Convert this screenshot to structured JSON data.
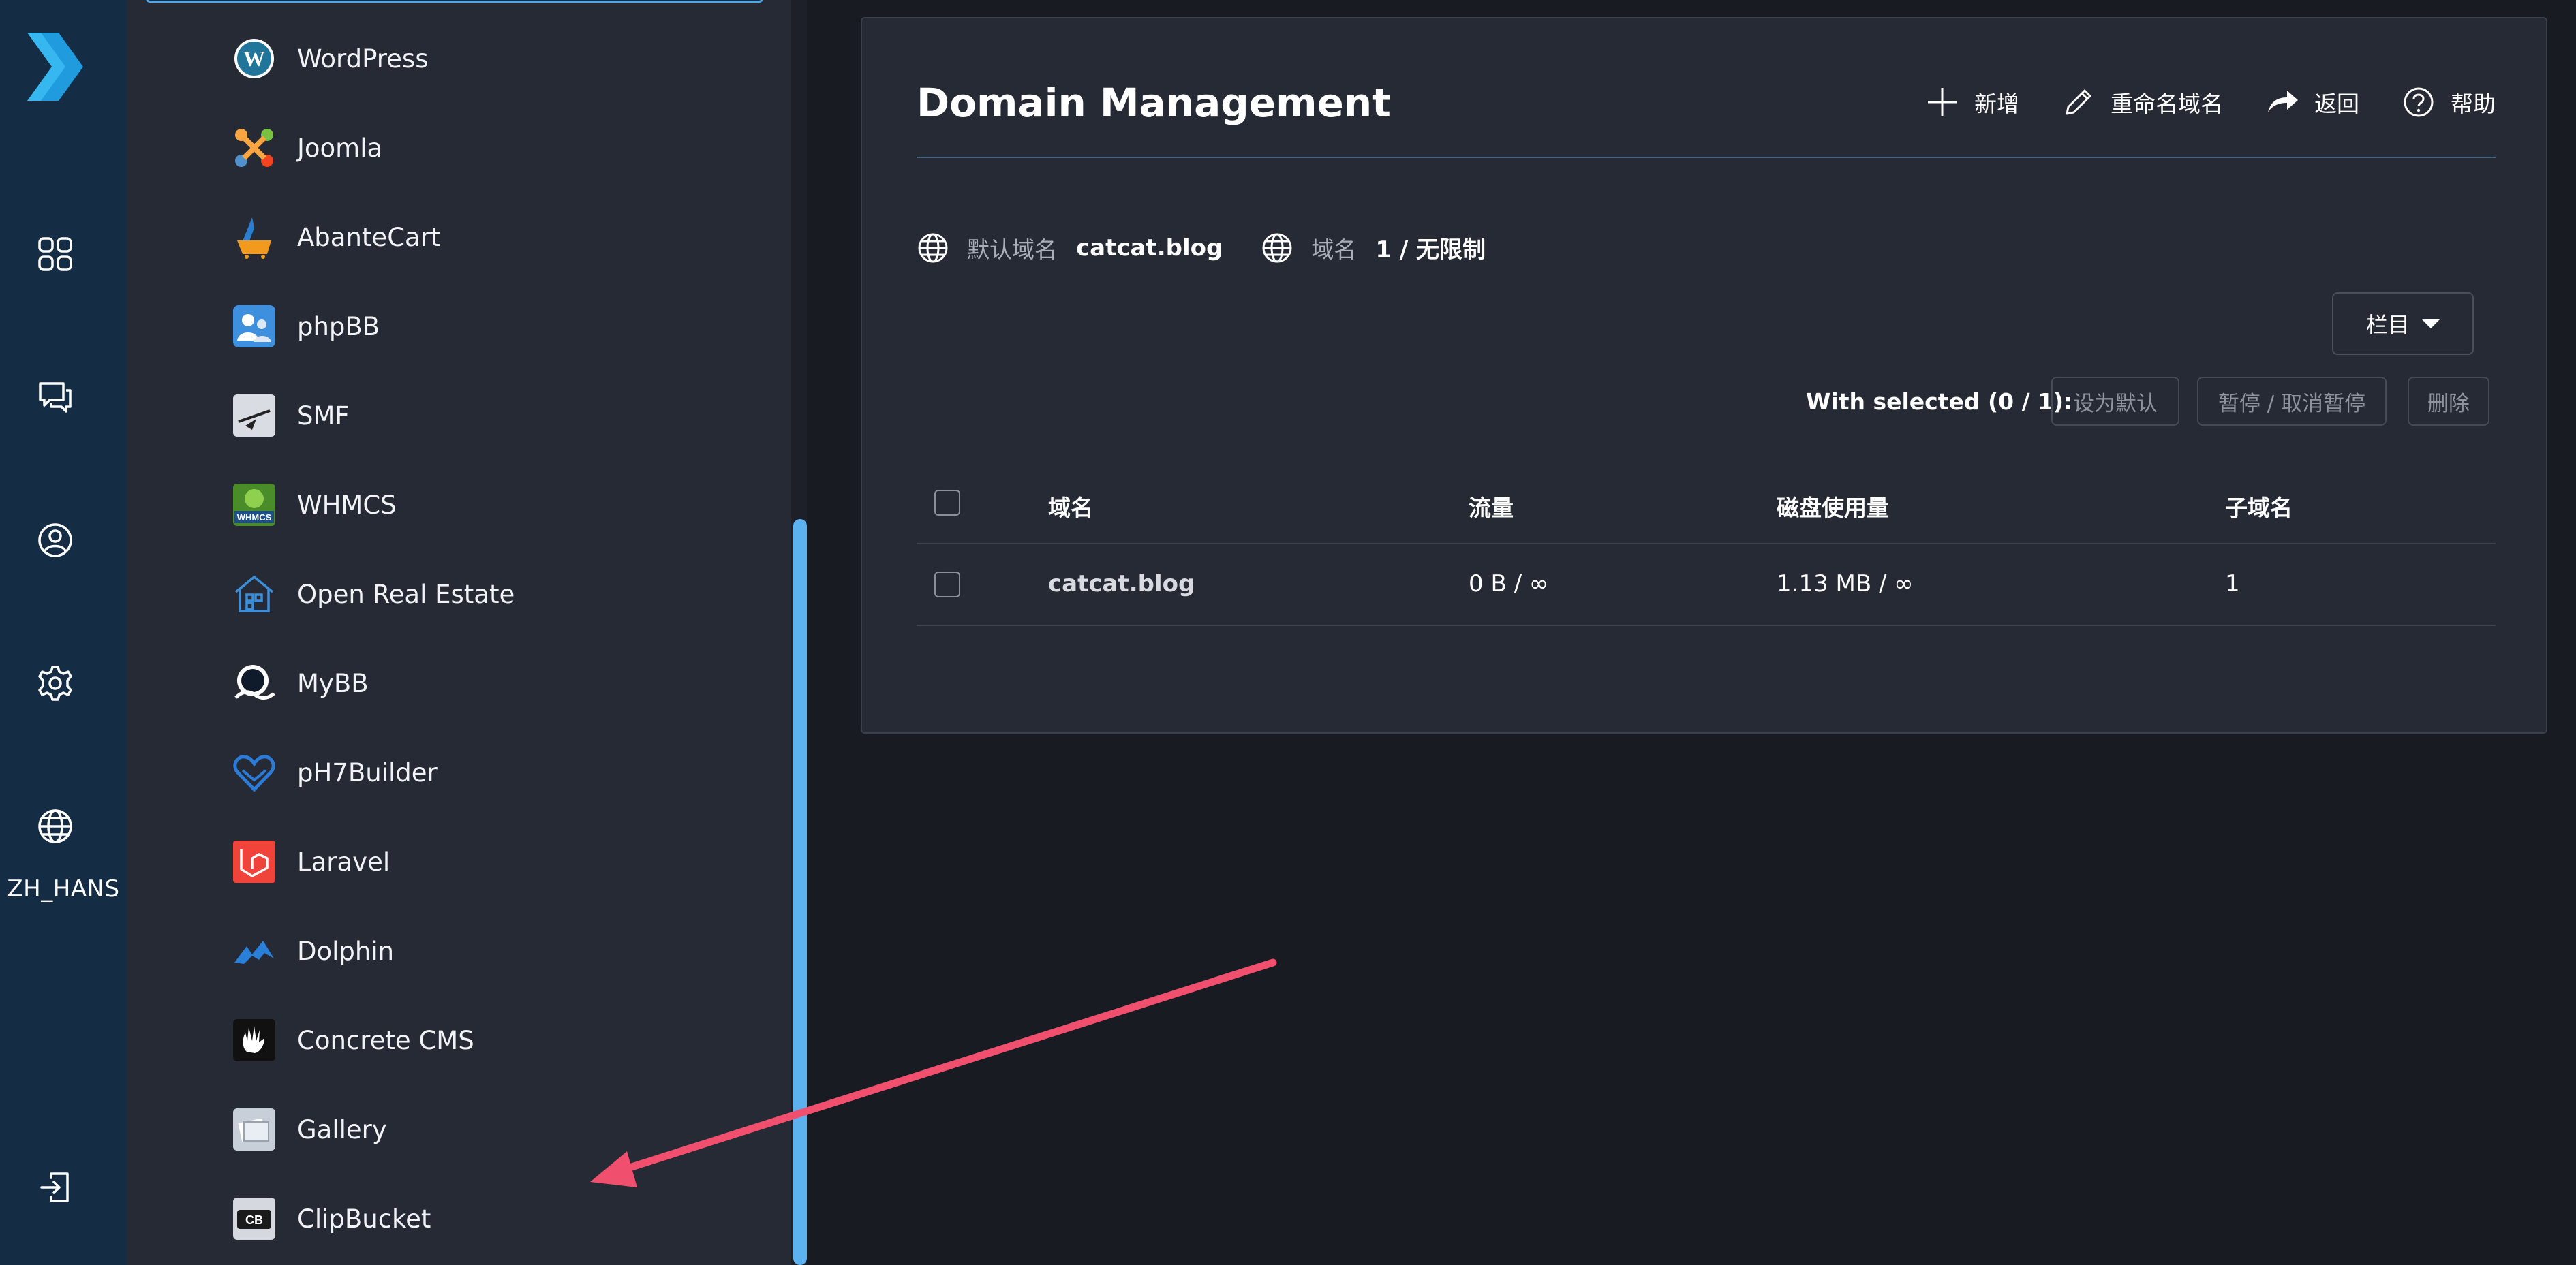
{
  "rail": {
    "lang_label": "ZH_HANS"
  },
  "apps": [
    {
      "label": "WordPress",
      "icon": "wordpress-icon"
    },
    {
      "label": "Joomla",
      "icon": "joomla-icon"
    },
    {
      "label": "AbanteCart",
      "icon": "abantecart-icon"
    },
    {
      "label": "phpBB",
      "icon": "phpbb-icon"
    },
    {
      "label": "SMF",
      "icon": "smf-icon"
    },
    {
      "label": "WHMCS",
      "icon": "whmcs-icon"
    },
    {
      "label": "Open Real Estate",
      "icon": "open-real-estate-icon"
    },
    {
      "label": "MyBB",
      "icon": "mybb-icon"
    },
    {
      "label": "pH7Builder",
      "icon": "ph7builder-icon"
    },
    {
      "label": "Laravel",
      "icon": "laravel-icon"
    },
    {
      "label": "Dolphin",
      "icon": "dolphin-icon"
    },
    {
      "label": "Concrete CMS",
      "icon": "concrete-cms-icon"
    },
    {
      "label": "Gallery",
      "icon": "gallery-icon"
    },
    {
      "label": "ClipBucket",
      "icon": "clipbucket-icon"
    }
  ],
  "main": {
    "title": "Domain Management",
    "toolbar": {
      "add": "新增",
      "rename": "重命名域名",
      "back": "返回",
      "help": "帮助"
    },
    "info": {
      "default_domain_key": "默认域名",
      "default_domain_value": "catcat.blog",
      "domains_key": "域名",
      "domains_value": "1 / 无限制"
    },
    "columns_button": "栏目",
    "with_selected": "With selected (0 / 1):",
    "actions": {
      "set_default": "设为默认",
      "suspend": "暂停 / 取消暂停",
      "delete": "删除"
    },
    "table": {
      "headers": [
        "域名",
        "流量",
        "磁盘使用量",
        "子域名"
      ],
      "rows": [
        {
          "domain": "catcat.blog",
          "traffic": "0 B / ∞",
          "disk": "1.13 MB / ∞",
          "subdomains": "1"
        }
      ]
    }
  },
  "colors": {
    "rail_bg": "#142c44",
    "panel_bg": "#262a35",
    "page_bg": "#181b22",
    "accent": "#4fa7e6",
    "annotation_arrow": "#f0506e"
  }
}
